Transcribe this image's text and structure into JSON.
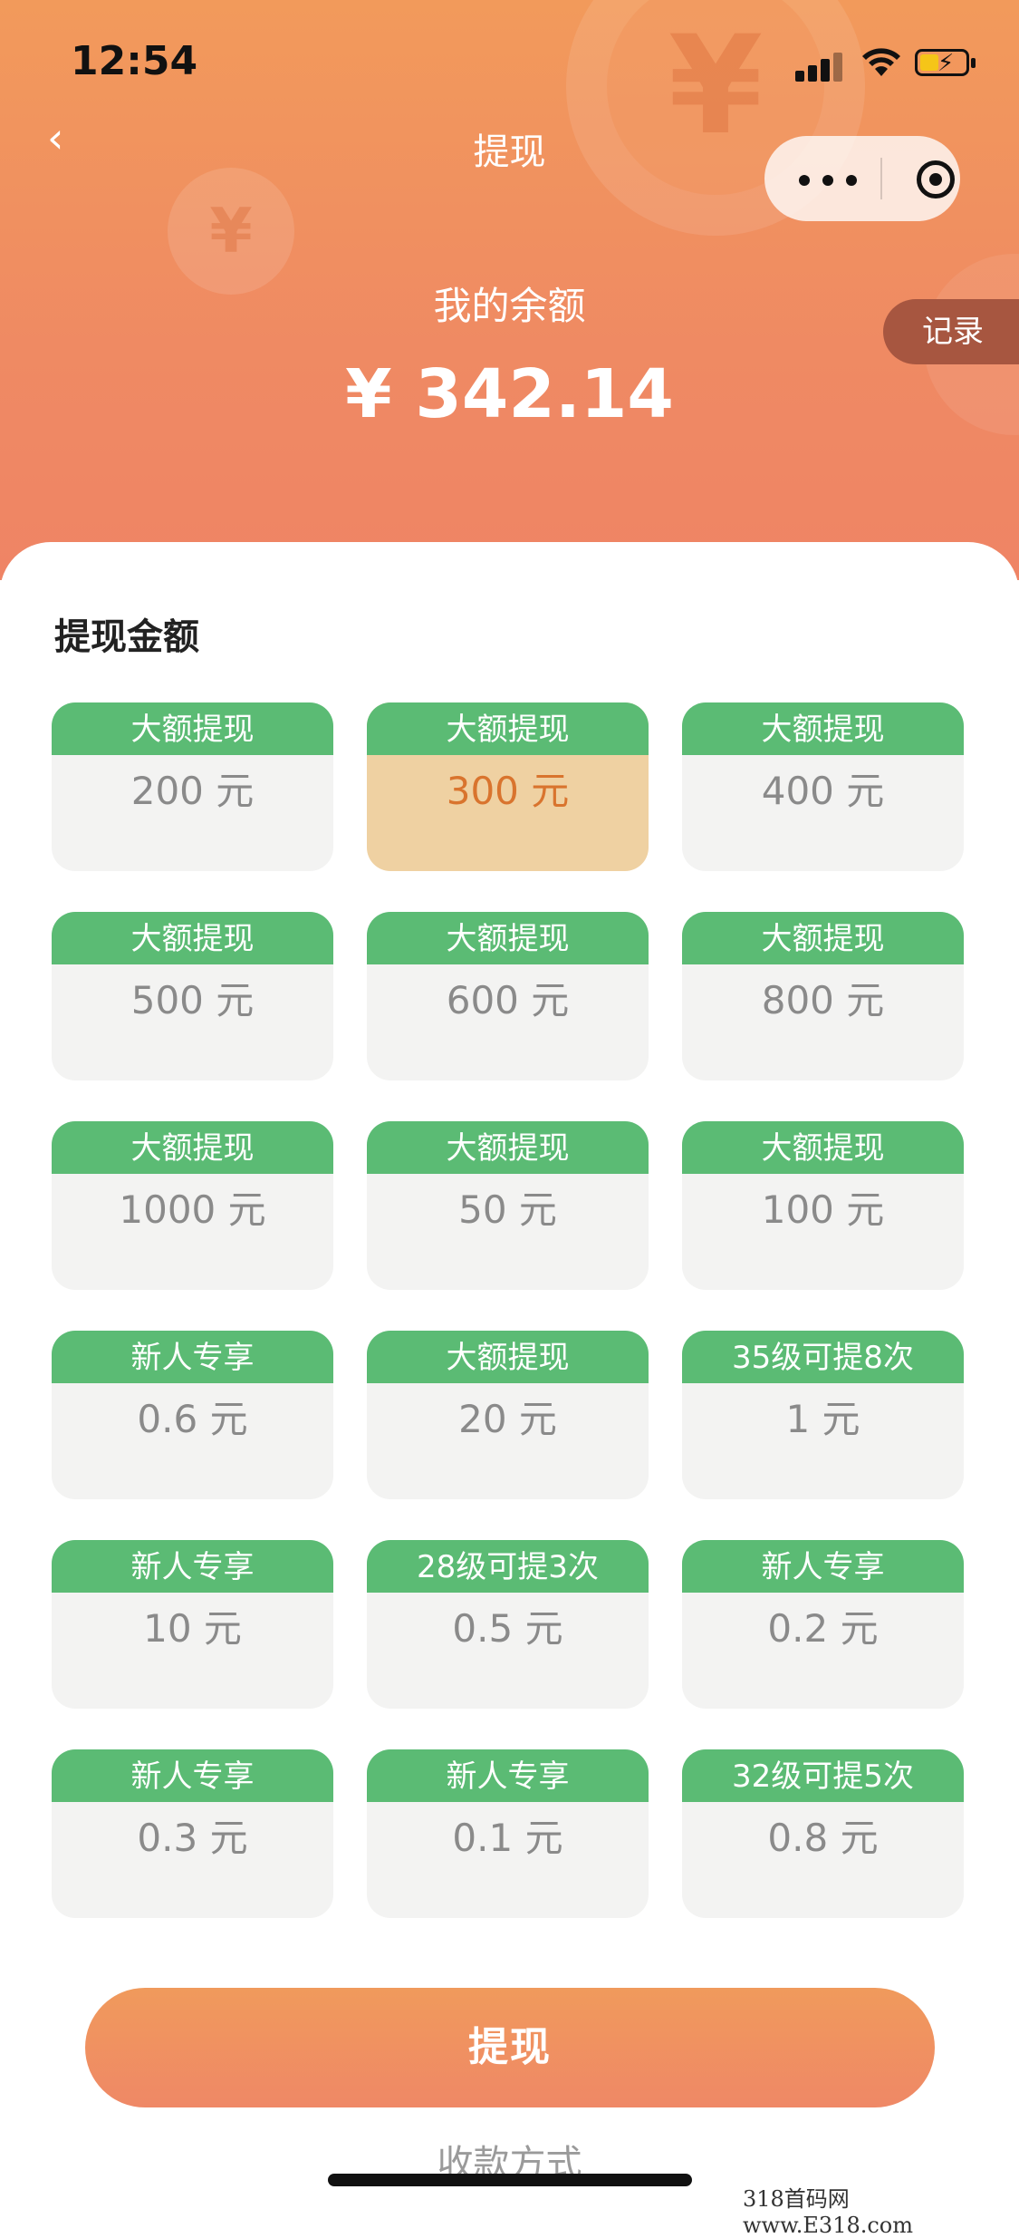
{
  "status_bar": {
    "time": "12:54"
  },
  "nav": {
    "back_icon": "‹",
    "title": "提现",
    "record_label": "记录"
  },
  "balance": {
    "label": "我的余额",
    "amount": "¥ 342.14"
  },
  "section_title": "提现金额",
  "options": [
    {
      "tag": "大额提现",
      "amount": "200 元",
      "selected": false
    },
    {
      "tag": "大额提现",
      "amount": "300 元",
      "selected": true
    },
    {
      "tag": "大额提现",
      "amount": "400 元",
      "selected": false
    },
    {
      "tag": "大额提现",
      "amount": "500 元",
      "selected": false
    },
    {
      "tag": "大额提现",
      "amount": "600 元",
      "selected": false
    },
    {
      "tag": "大额提现",
      "amount": "800 元",
      "selected": false
    },
    {
      "tag": "大额提现",
      "amount": "1000 元",
      "selected": false
    },
    {
      "tag": "大额提现",
      "amount": "50 元",
      "selected": false
    },
    {
      "tag": "大额提现",
      "amount": "100 元",
      "selected": false
    },
    {
      "tag": "新人专享",
      "amount": "0.6 元",
      "selected": false
    },
    {
      "tag": "大额提现",
      "amount": "20 元",
      "selected": false
    },
    {
      "tag": "35级可提8次",
      "amount": "1 元",
      "selected": false
    },
    {
      "tag": "新人专享",
      "amount": "10 元",
      "selected": false
    },
    {
      "tag": "28级可提3次",
      "amount": "0.5 元",
      "selected": false
    },
    {
      "tag": "新人专享",
      "amount": "0.2 元",
      "selected": false
    },
    {
      "tag": "新人专享",
      "amount": "0.3 元",
      "selected": false
    },
    {
      "tag": "新人专享",
      "amount": "0.1 元",
      "selected": false
    },
    {
      "tag": "32级可提5次",
      "amount": "0.8 元",
      "selected": false
    }
  ],
  "submit_label": "提现",
  "pay_method_label": "收款方式",
  "watermark": "318首码网 www.E318.com",
  "decor": {
    "coin_symbol": "¥"
  },
  "colors": {
    "accent": "#ef8a63",
    "tag_green": "#5bbb74",
    "selected_bg": "#efd1a2",
    "selected_text": "#d9742e"
  }
}
